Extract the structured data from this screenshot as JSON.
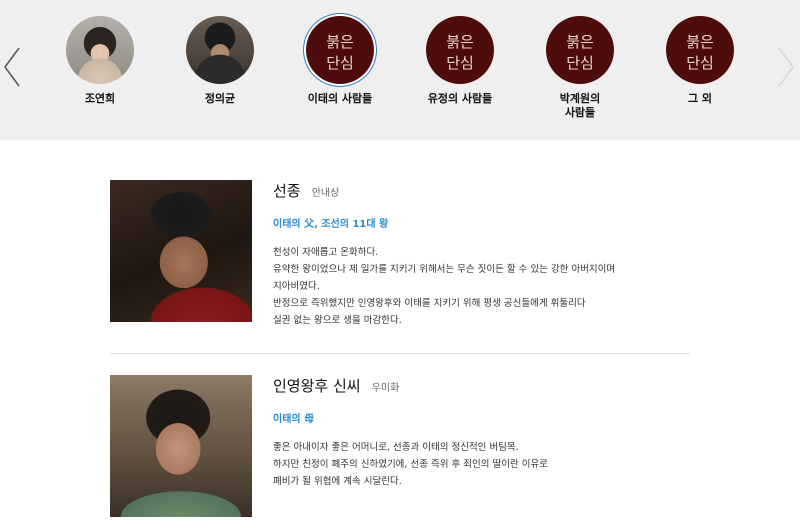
{
  "categories": [
    {
      "label": "조연희",
      "kind": "woman-photo",
      "selected": false
    },
    {
      "label": "정의균",
      "kind": "man-photo",
      "selected": false
    },
    {
      "label": "이태의 사람들",
      "kind": "logo",
      "selected": true
    },
    {
      "label": "유정의 사람들",
      "kind": "logo",
      "selected": false
    },
    {
      "label": "박계원의\n사람들",
      "kind": "logo",
      "selected": false
    },
    {
      "label": "그 외",
      "kind": "logo",
      "selected": false
    }
  ],
  "logo_text": [
    "붉은",
    "단심"
  ],
  "colors": {
    "relation": "#2a8ad0",
    "selected_ring": "#2b7fc3",
    "logo_bg": "#4d0b0b"
  },
  "profiles": [
    {
      "name": "선종",
      "actor": "안내상",
      "relation": "이태의 父, 조선의 11대 왕",
      "desc": [
        "천성이 자애롭고 온화하다.",
        "유약한 왕이었으나 제 일가를 지키기 위해서는 무슨 짓이든 할 수 있는 강한 아버지이며",
        "지아비였다.",
        "반정으로 즉위했지만 인영왕후와 이태를 지키기 위해 평생 공신들에게 휘둘리다",
        "실권 없는 왕으로 생을 마감한다."
      ]
    },
    {
      "name": "인영왕후 신씨",
      "actor": "우미화",
      "relation": "이태의 母",
      "desc": [
        "좋은 아내이자 좋은 어머니로, 선종과 이태의 정신적인 버팀목.",
        "하지만 친정이 폐주의 신하였기에, 선종 즉위 후 죄인의 딸이란 이유로",
        "폐비가 될 위협에 계속 시달린다."
      ]
    }
  ],
  "icons": {
    "prev": "chevron-left-icon",
    "next": "chevron-right-icon"
  }
}
